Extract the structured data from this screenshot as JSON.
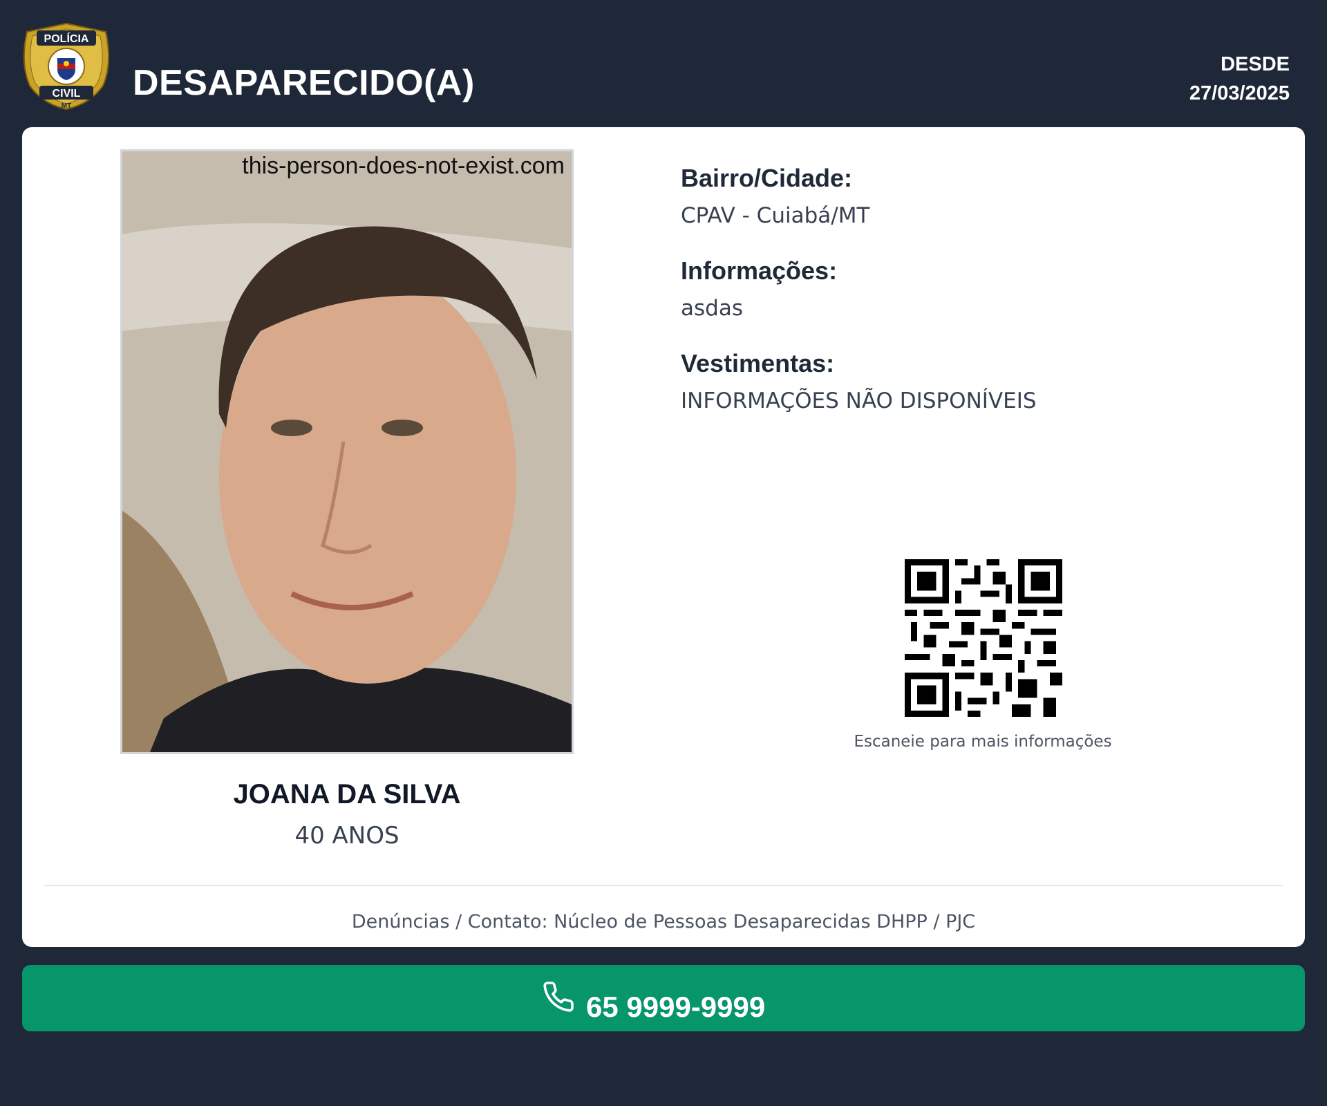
{
  "header": {
    "logo": {
      "name": "policia-civil-mt-badge",
      "text_top": "POLÍCIA",
      "text_middle": "CIVIL",
      "text_bottom": "MT"
    },
    "title": "DESAPARECIDO(A)",
    "since_label": "DESDE",
    "since_date": "27/03/2025"
  },
  "person": {
    "photo_watermark": "this-person-does-not-exist.com",
    "name": "JOANA DA SILVA",
    "age": "40 ANOS"
  },
  "details": [
    {
      "label": "Bairro/Cidade:",
      "value": "CPAV - Cuiabá/MT"
    },
    {
      "label": "Informações:",
      "value": "asdas"
    },
    {
      "label": "Vestimentas:",
      "value": "INFORMAÇÕES NÃO DISPONÍVEIS"
    }
  ],
  "qr": {
    "icon": "qr-code-icon",
    "caption": "Escaneie para mais informações"
  },
  "footer": {
    "contact": "Denúncias / Contato: Núcleo de Pessoas Desaparecidas DHPP / PJC"
  },
  "phone": {
    "icon": "phone-icon",
    "number": "65 9999-9999"
  },
  "colors": {
    "background": "#1f2838",
    "card": "#ffffff",
    "accent_green": "#07956a",
    "badge_gold": "#c9a227"
  }
}
